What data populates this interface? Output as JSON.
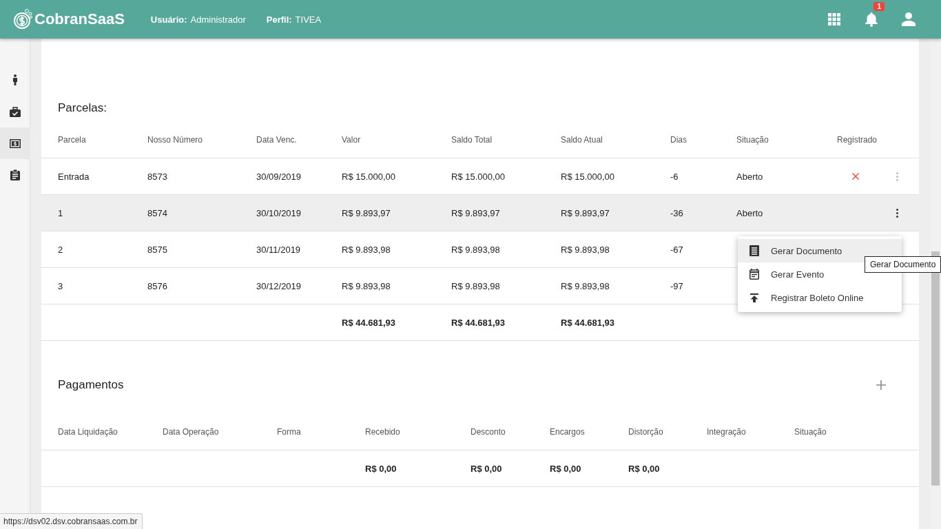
{
  "header": {
    "logo": "CobranSaaS",
    "user_label": "Usuário:",
    "user": "Administrador",
    "profile_label": "Perfil:",
    "profile": "TIVEA",
    "notification_count": "1"
  },
  "sidebar": {
    "items": [
      {
        "kind": "person",
        "selected": false
      },
      {
        "kind": "briefcase",
        "selected": false
      },
      {
        "kind": "money",
        "selected": true
      },
      {
        "kind": "clipboard",
        "selected": false
      }
    ]
  },
  "parcelas": {
    "title": "Parcelas:",
    "columns": [
      "Parcela",
      "Nosso Número",
      "Data Venc.",
      "Valor",
      "Saldo Total",
      "Saldo Atual",
      "Dias",
      "Situação",
      "Registrado"
    ],
    "rows": [
      {
        "cells": [
          "Entrada",
          "8573",
          "30/09/2019",
          "R$ 15.000,00",
          "R$ 15.000,00",
          "R$ 15.000,00",
          "-6"
        ],
        "situacao": "Aberto",
        "registrado": false,
        "hovered": false,
        "menu_button": true
      },
      {
        "cells": [
          "1",
          "8574",
          "30/10/2019",
          "R$ 9.893,97",
          "R$ 9.893,97",
          "R$ 9.893,97",
          "-36"
        ],
        "situacao": "Aberto",
        "hovered": true,
        "menu_button": true
      },
      {
        "cells": [
          "2",
          "8575",
          "30/11/2019",
          "R$ 9.893,98",
          "R$ 9.893,98",
          "R$ 9.893,98",
          "-67"
        ],
        "hovered": false,
        "menu_button": false
      },
      {
        "cells": [
          "3",
          "8576",
          "30/12/2019",
          "R$ 9.893,98",
          "R$ 9.893,98",
          "R$ 9.893,98",
          "-97"
        ],
        "hovered": false,
        "menu_button": false
      }
    ],
    "totals": {
      "valor": "R$ 44.681,93",
      "saldo_total": "R$ 44.681,93",
      "saldo_atual": "R$ 44.681,93"
    }
  },
  "pagamentos": {
    "title": "Pagamentos",
    "columns": [
      "Data Liquidação",
      "Data Operação",
      "Forma",
      "Recebido",
      "Desconto",
      "Encargos",
      "Distorção",
      "Integração",
      "Situação"
    ],
    "totals": {
      "recebido": "R$ 0,00",
      "desconto": "R$ 0,00",
      "encargos": "R$ 0,00",
      "distorcao": "R$ 0,00"
    }
  },
  "menu": {
    "items": [
      {
        "kind": "document",
        "label": "Gerar Documento",
        "selected": true
      },
      {
        "kind": "event",
        "label": "Gerar Evento",
        "selected": false
      },
      {
        "kind": "upload",
        "label": "Registrar Boleto Online",
        "selected": false
      }
    ],
    "tooltip": "Gerar Documento"
  },
  "status_url": "https://dsv02.dsv.cobransaas.com.br"
}
